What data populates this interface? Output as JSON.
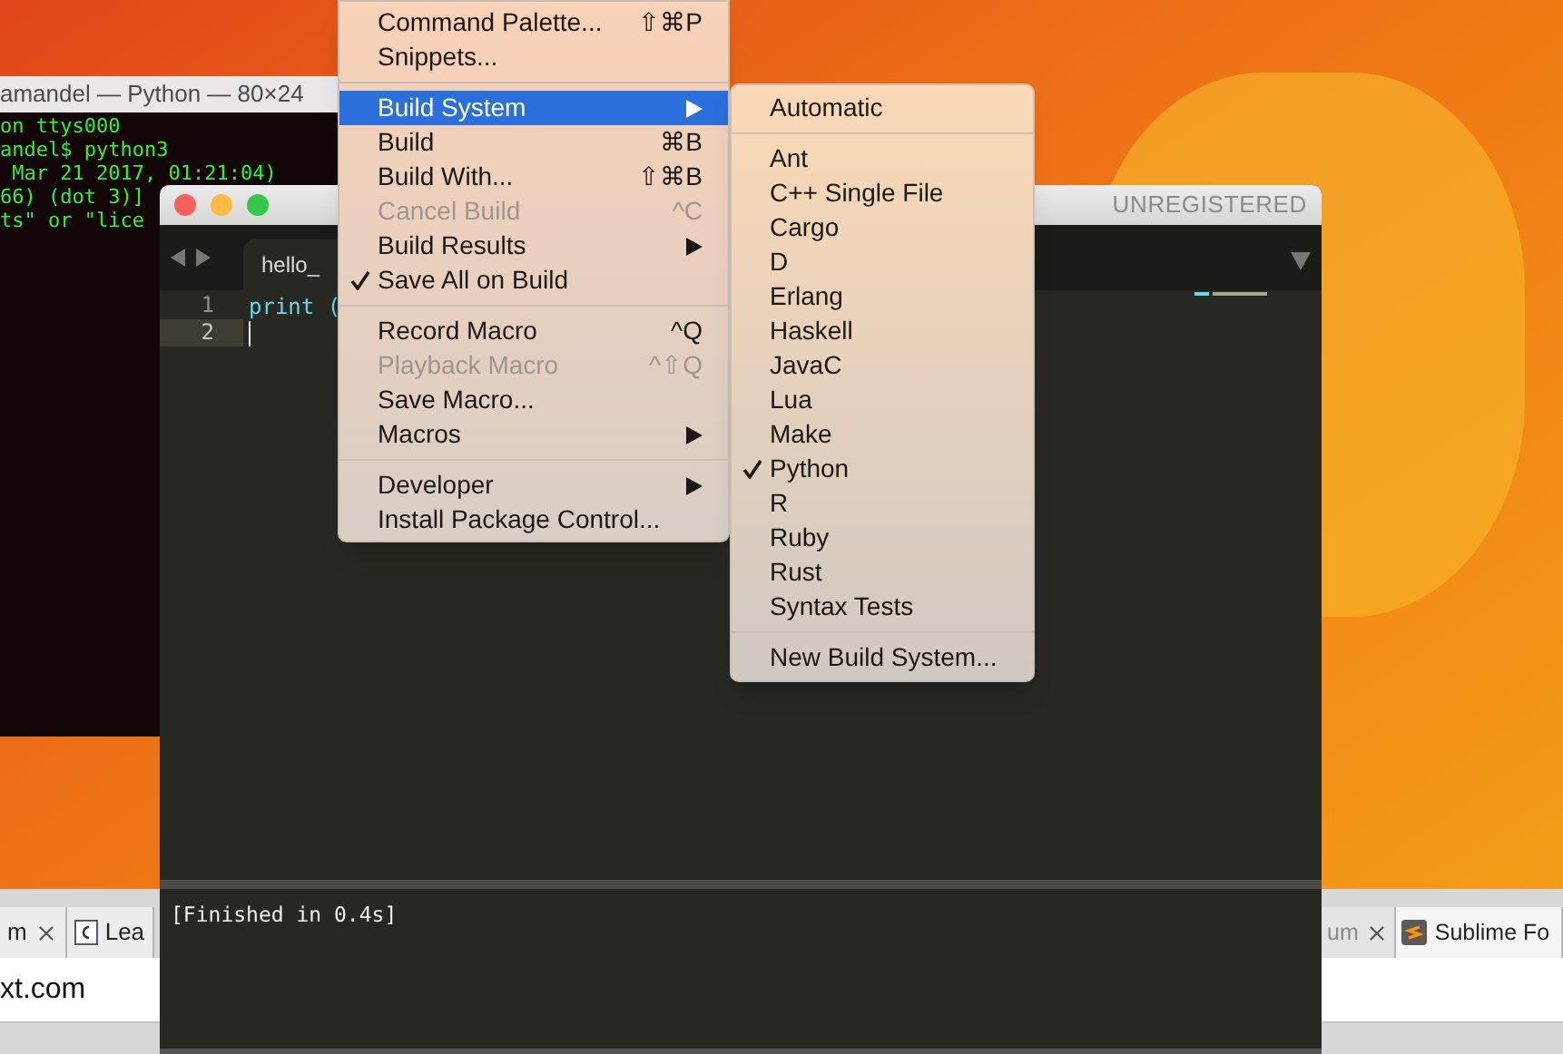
{
  "terminal": {
    "title": "amandel — Python — 80×24",
    "lines": [
      "on ttys000",
      "andel$ python3",
      " Mar 21 2017, 01:21:04)",
      "66) (dot 3)]",
      "ts\" or \"lice"
    ]
  },
  "editor": {
    "badge": "UNREGISTERED",
    "tab": {
      "label": "hello_"
    },
    "lines": [
      {
        "number": "1",
        "code": "print (",
        "current": false
      },
      {
        "number": "2",
        "current": true
      }
    ],
    "output": "[Finished in 0.4s]"
  },
  "menu": {
    "items": [
      {
        "kind": "item",
        "label": "Command Palette...",
        "shortcut": "⇧⌘P",
        "selected": false,
        "disabled": false,
        "checked": false,
        "submenu": false
      },
      {
        "kind": "item",
        "label": "Snippets...",
        "selected": false,
        "disabled": false,
        "checked": false,
        "submenu": false
      },
      {
        "kind": "separator"
      },
      {
        "kind": "item",
        "label": "Build System",
        "selected": true,
        "disabled": false,
        "checked": false,
        "submenu": true
      },
      {
        "kind": "item",
        "label": "Build",
        "shortcut": "⌘B",
        "selected": false,
        "disabled": false,
        "checked": false,
        "submenu": false
      },
      {
        "kind": "item",
        "label": "Build With...",
        "shortcut": "⇧⌘B",
        "selected": false,
        "disabled": false,
        "checked": false,
        "submenu": false
      },
      {
        "kind": "item",
        "label": "Cancel Build",
        "shortcut": "^C",
        "selected": false,
        "disabled": true,
        "checked": false,
        "submenu": false
      },
      {
        "kind": "item",
        "label": "Build Results",
        "selected": false,
        "disabled": false,
        "checked": false,
        "submenu": true
      },
      {
        "kind": "item",
        "label": "Save All on Build",
        "selected": false,
        "disabled": false,
        "checked": true,
        "submenu": false
      },
      {
        "kind": "separator"
      },
      {
        "kind": "item",
        "label": "Record Macro",
        "shortcut": "^Q",
        "selected": false,
        "disabled": false,
        "checked": false,
        "submenu": false
      },
      {
        "kind": "item",
        "label": "Playback Macro",
        "shortcut": "^⇧Q",
        "selected": false,
        "disabled": true,
        "checked": false,
        "submenu": false
      },
      {
        "kind": "item",
        "label": "Save Macro...",
        "selected": false,
        "disabled": false,
        "checked": false,
        "submenu": false
      },
      {
        "kind": "item",
        "label": "Macros",
        "selected": false,
        "disabled": false,
        "checked": false,
        "submenu": true
      },
      {
        "kind": "separator"
      },
      {
        "kind": "item",
        "label": "Developer",
        "selected": false,
        "disabled": false,
        "checked": false,
        "submenu": true
      },
      {
        "kind": "item",
        "label": "Install Package Control...",
        "selected": false,
        "disabled": false,
        "checked": false,
        "submenu": false
      }
    ]
  },
  "submenu": {
    "items": [
      {
        "kind": "item",
        "label": "Automatic",
        "checked": false
      },
      {
        "kind": "separator"
      },
      {
        "kind": "item",
        "label": "Ant",
        "checked": false
      },
      {
        "kind": "item",
        "label": "C++ Single File",
        "checked": false
      },
      {
        "kind": "item",
        "label": "Cargo",
        "checked": false
      },
      {
        "kind": "item",
        "label": "D",
        "checked": false
      },
      {
        "kind": "item",
        "label": "Erlang",
        "checked": false
      },
      {
        "kind": "item",
        "label": "Haskell",
        "checked": false
      },
      {
        "kind": "item",
        "label": "JavaC",
        "checked": false
      },
      {
        "kind": "item",
        "label": "Lua",
        "checked": false
      },
      {
        "kind": "item",
        "label": "Make",
        "checked": false
      },
      {
        "kind": "item",
        "label": "Python",
        "checked": true
      },
      {
        "kind": "item",
        "label": "R",
        "checked": false
      },
      {
        "kind": "item",
        "label": "Ruby",
        "checked": false
      },
      {
        "kind": "item",
        "label": "Rust",
        "checked": false
      },
      {
        "kind": "item",
        "label": "Syntax Tests",
        "checked": false
      },
      {
        "kind": "separator"
      },
      {
        "kind": "item",
        "label": "New Build System...",
        "checked": false
      }
    ]
  },
  "browser": {
    "left_tabs": [
      {
        "label": "m",
        "icon": false
      },
      {
        "label": "Lea",
        "icon": true
      }
    ],
    "address": "xt.com",
    "right_tabs": [
      {
        "label": "um",
        "icon": false
      },
      {
        "label": "Sublime Fo",
        "icon": true
      }
    ]
  }
}
